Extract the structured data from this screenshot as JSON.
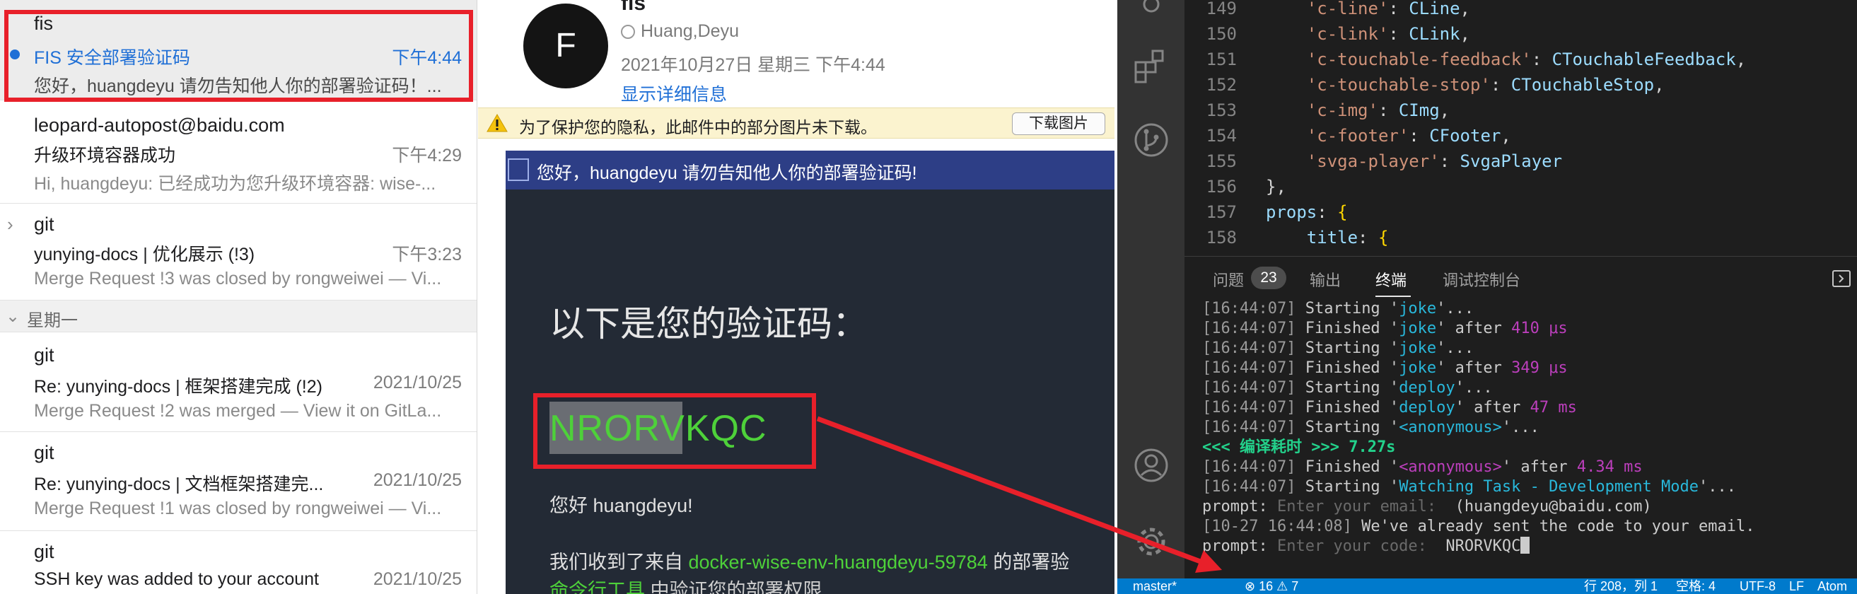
{
  "mail_list": {
    "items": [
      {
        "sender": "fis",
        "subject": "FIS 安全部署验证码",
        "date": "下午4:44",
        "preview": "您好，huangdeyu 请勿告知他人你的部署验证码！..."
      },
      {
        "sender": "leopard-autopost@baidu.com",
        "subject": "升级环境容器成功",
        "date": "下午4:29",
        "preview": "Hi, huangdeyu: 已经成功为您升级环境容器: wise-..."
      },
      {
        "sender": "git",
        "subject": "yunying-docs | 优化展示 (!3)",
        "date": "下午3:23",
        "preview": "Merge Request !3 was closed by rongweiwei — Vi..."
      },
      {
        "sender": "git",
        "subject": "Re: yunying-docs | 框架搭建完成 (!2)",
        "date": "2021/10/25",
        "preview": "Merge Request !2 was merged — View it on GitLa..."
      },
      {
        "sender": "git",
        "subject": "Re: yunying-docs | 文档框架搭建完...",
        "date": "2021/10/25",
        "preview": "Merge Request !1 was closed by rongweiwei — Vi..."
      },
      {
        "sender": "git",
        "subject": "SSH key was added to your account",
        "date": "2021/10/25",
        "preview": ""
      }
    ],
    "section_header": "星期一"
  },
  "message": {
    "avatar_letter": "F",
    "sender": "fis",
    "to": "Huang,Deyu",
    "date": "2021年10月27日 星期三 下午4:44",
    "details_link": "显示详细信息",
    "privacy_text": "为了保护您的隐私，此邮件中的部分图片未下载。",
    "download_button": "下载图片",
    "header_title": "您好，huangdeyu 请勿告知他人你的部署验证码!",
    "code_heading": "以下是您的验证码：",
    "code": "NRORVKQC",
    "greeting": "您好 huangdeyu!",
    "received_prefix": "我们收到了来自 ",
    "received_env": "docker-wise-env-huangdeyu-59784",
    "received_suffix": " 的部署验",
    "cli_link": "命令行工具",
    "cli_suffix": " 中验证您的部署权限"
  },
  "editor": {
    "lines": [
      {
        "n": "149",
        "key": "'c-line'",
        "val": "CLine"
      },
      {
        "n": "150",
        "key": "'c-link'",
        "val": "CLink"
      },
      {
        "n": "151",
        "key": "'c-touchable-feedback'",
        "val": "CTouchableFeedback"
      },
      {
        "n": "152",
        "key": "'c-touchable-stop'",
        "val": "CTouchableStop"
      },
      {
        "n": "153",
        "key": "'c-img'",
        "val": "CImg"
      },
      {
        "n": "154",
        "key": "'c-footer'",
        "val": "CFooter"
      },
      {
        "n": "155",
        "key": "'svga-player'",
        "val": "SvgaPlayer"
      }
    ],
    "line156": {
      "n": "156",
      "text": "},"
    },
    "line157": {
      "n": "157",
      "key": "props",
      "brace": "{"
    },
    "line158": {
      "n": "158",
      "key": "title",
      "brace": "{"
    }
  },
  "panel": {
    "tabs": [
      "问题",
      "输出",
      "终端",
      "调试控制台"
    ],
    "problems_count": "23",
    "active_tab": "终端"
  },
  "terminal": {
    "lines": [
      {
        "time": "16:44:07",
        "verb": "Starting",
        "task": "joke",
        "rest": "..."
      },
      {
        "time": "16:44:07",
        "verb": "Finished",
        "task": "joke",
        "after": " after ",
        "dur": "410 μs"
      },
      {
        "time": "16:44:07",
        "verb": "Starting",
        "task": "joke",
        "rest": "..."
      },
      {
        "time": "16:44:07",
        "verb": "Finished",
        "task": "joke",
        "after": " after ",
        "dur": "349 μs"
      },
      {
        "time": "16:44:07",
        "verb": "Starting",
        "task": "deploy",
        "rest": "..."
      },
      {
        "time": "16:44:07",
        "verb": "Finished",
        "task": "deploy",
        "after": " after ",
        "dur": "47 ms"
      },
      {
        "time": "16:44:07",
        "verb": "Starting",
        "task": "<anonymous>",
        "rest": "..."
      }
    ],
    "compile_time": "<<< 编译耗时 >>> 7.27s",
    "finished_anon": {
      "time": "16:44:07",
      "verb": "Finished",
      "task": "<anonymous>",
      "after": " after ",
      "dur": "4.34 ms"
    },
    "watching": {
      "time": "16:44:07",
      "verb": "Starting",
      "task": "Watching Task - Development Mode",
      "rest": "..."
    },
    "prompt_email": {
      "label": "prompt: ",
      "placeholder": "Enter your email:",
      "value": "  (huangdeyu@baidu.com)"
    },
    "sent_line": {
      "time": "10-27 16:44:08",
      "text": " We've already sent the code to your email."
    },
    "prompt_code": {
      "label": "prompt: ",
      "placeholder": "Enter your code:",
      "value": "  NRORVKQC"
    }
  },
  "status_bar": {
    "branch": "master*",
    "problems": "⊗ 16 ⚠ 7",
    "position": "行 208，列 1",
    "spaces": "空格: 4",
    "encoding": "UTF-8",
    "eol": "LF",
    "lang": "Atom"
  },
  "colors": {
    "accent_blue": "#1f6fd6",
    "annotation_red": "#e8202a",
    "code_green": "#4ed13a",
    "status_bar": "#007acc"
  }
}
